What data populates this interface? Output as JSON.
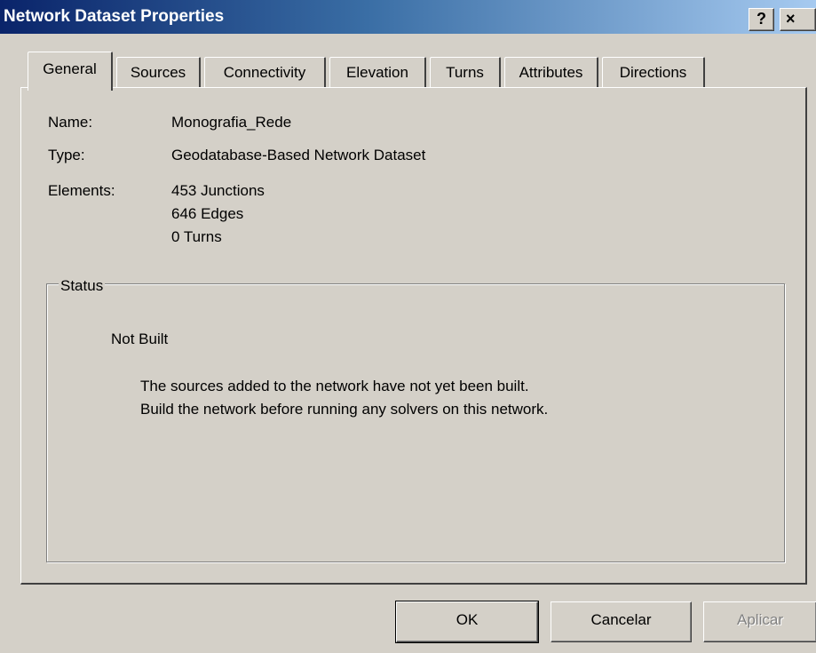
{
  "window": {
    "title": "Network Dataset Properties",
    "help_label": "?",
    "close_label": "×"
  },
  "tabs": [
    {
      "label": "General",
      "active": true
    },
    {
      "label": "Sources"
    },
    {
      "label": "Connectivity"
    },
    {
      "label": "Elevation"
    },
    {
      "label": "Turns"
    },
    {
      "label": "Attributes"
    },
    {
      "label": "Directions"
    }
  ],
  "general": {
    "name_label": "Name:",
    "name_value": "Monografia_Rede",
    "type_label": "Type:",
    "type_value": "Geodatabase-Based Network Dataset",
    "elements_label": "Elements:",
    "elements": [
      "453 Junctions",
      "646 Edges",
      "0 Turns"
    ]
  },
  "status": {
    "group_label": "Status",
    "state": "Not Built",
    "message_line1": "The sources added to the network have not yet been built.",
    "message_line2": "Build the network before running any solvers on this network."
  },
  "buttons": {
    "ok": "OK",
    "cancel": "Cancelar",
    "apply": "Aplicar"
  }
}
